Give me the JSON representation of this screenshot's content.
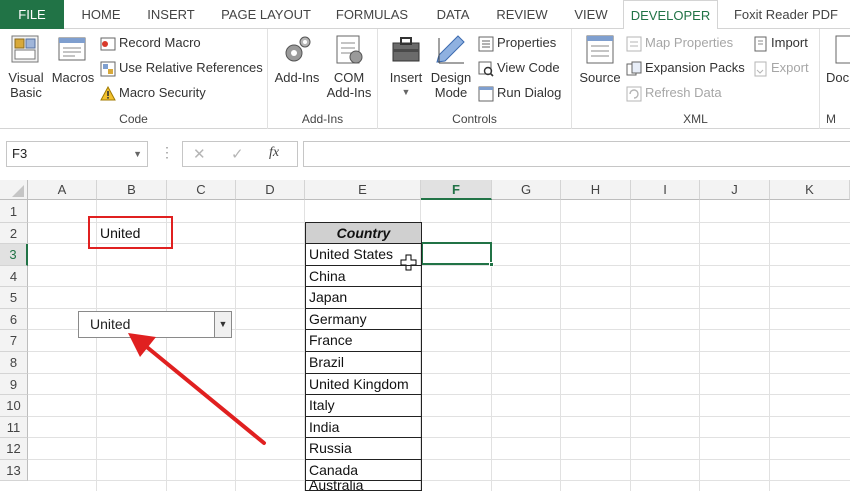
{
  "tabs": [
    "FILE",
    "HOME",
    "INSERT",
    "PAGE LAYOUT",
    "FORMULAS",
    "DATA",
    "REVIEW",
    "VIEW",
    "DEVELOPER",
    "Foxit Reader PDF"
  ],
  "active_tab": "DEVELOPER",
  "ribbon": {
    "code": {
      "label": "Code",
      "visual_basic": [
        "Visual",
        "Basic"
      ],
      "macros": "Macros",
      "record_macro": "Record Macro",
      "relative_refs": "Use Relative References",
      "macro_security": "Macro Security"
    },
    "addins": {
      "label": "Add-Ins",
      "addins": "Add-Ins",
      "com_addins": [
        "COM",
        "Add-Ins"
      ]
    },
    "controls": {
      "label": "Controls",
      "insert": "Insert",
      "design_mode": [
        "Design",
        "Mode"
      ],
      "properties": "Properties",
      "view_code": "View Code",
      "run_dialog": "Run Dialog"
    },
    "xml": {
      "label": "XML",
      "source": "Source",
      "map_properties": "Map Properties",
      "expansion_packs": "Expansion Packs",
      "refresh_data": "Refresh Data",
      "import": "Import",
      "export": "Export"
    },
    "cutoff": {
      "label": "M",
      "button": "Doc"
    }
  },
  "formula_bar": {
    "name_box": "F3",
    "fx": "fx",
    "formula": ""
  },
  "sheet": {
    "columns": [
      "A",
      "B",
      "C",
      "D",
      "E",
      "F",
      "G",
      "H",
      "I",
      "J",
      "K"
    ],
    "rows": [
      "1",
      "2",
      "3",
      "4",
      "5",
      "6",
      "7",
      "8",
      "9",
      "10",
      "11",
      "12",
      "13"
    ],
    "selected_cell": "F3",
    "b2_value": "United",
    "combo_value": "United",
    "table_header": "Country",
    "countries": [
      "United States",
      "China",
      "Japan",
      "Germany",
      "France",
      "Brazil",
      "United Kingdom",
      "Italy",
      "India",
      "Russia",
      "Canada",
      "Australia"
    ]
  },
  "colors": {
    "excel_green": "#217346",
    "highlight_red": "#e02020",
    "arrow_red": "#e02020"
  }
}
